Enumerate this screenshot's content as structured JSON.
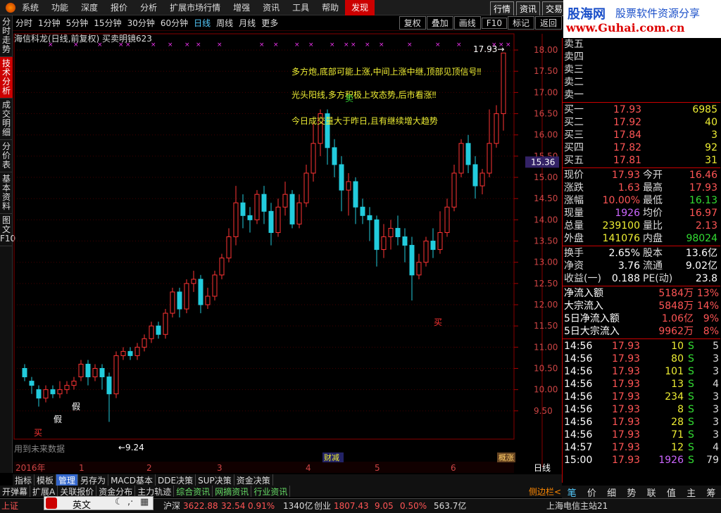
{
  "menu": [
    "系统",
    "功能",
    "深度",
    "报价",
    "分析",
    "扩展市场行情",
    "增强",
    "资讯",
    "工具",
    "帮助",
    "发现"
  ],
  "topright_btns": [
    "行情",
    "资讯",
    "交易"
  ],
  "brand": {
    "line1": "股海网",
    "line2": "股票软件资源分享",
    "line3": "www.Guhai.com.cn"
  },
  "left_tabs": [
    "分时走势",
    "技术分析",
    "成交明细",
    "分价表",
    "基本资料",
    "图文F10"
  ],
  "periods": [
    "分时",
    "1分钟",
    "5分钟",
    "15分钟",
    "30分钟",
    "60分钟",
    "日线",
    "周线",
    "月线",
    "更多"
  ],
  "active_period": "日线",
  "tool_btns": [
    "复权",
    "叠加",
    "画线",
    "F10",
    "标记",
    "返回"
  ],
  "chart_title": "海信科龙(日线,前复权) 买卖明镜623",
  "annotations": {
    "t1": "多方炮,底部可能上涨,中间上涨中继,顶部见顶信号‼",
    "t2": "光头阳线,多方积极上攻态势,后市看涨‼",
    "t3": "今日成交量大于昨日,且有继续增大趋势",
    "buy": "买",
    "fake": "假",
    "low": "9.24",
    "high": "17.93",
    "future": "用到未来数据",
    "finance": "财减",
    "caption": "概涨",
    "cur_price": "15.36"
  },
  "chart_data": {
    "type": "candlestick",
    "ylim": [
      9.0,
      18.2
    ],
    "yticks": [
      "18.00",
      "17.50",
      "17.00",
      "16.50",
      "16.00",
      "15.50",
      "15.00",
      "14.50",
      "14.00",
      "13.50",
      "13.00",
      "12.50",
      "12.00",
      "11.50",
      "11.00",
      "10.50",
      "10.00",
      "9.50"
    ],
    "xlabels": [
      "2016年",
      "1",
      "2",
      "3",
      "4",
      "5",
      "6"
    ],
    "candles": [
      [
        10.5,
        10.3,
        10.6,
        10.2
      ],
      [
        10.2,
        10.1,
        10.3,
        9.9
      ],
      [
        10.0,
        9.8,
        10.1,
        9.6
      ],
      [
        9.8,
        10.0,
        10.1,
        9.7
      ],
      [
        10.0,
        9.9,
        10.1,
        9.8
      ],
      [
        9.9,
        10.0,
        10.2,
        9.8
      ],
      [
        10.0,
        10.1,
        10.2,
        9.9
      ],
      [
        10.1,
        10.2,
        10.3,
        10.0
      ],
      [
        10.3,
        10.6,
        10.7,
        10.2
      ],
      [
        10.6,
        10.3,
        10.7,
        10.1
      ],
      [
        10.3,
        10.5,
        10.6,
        10.2
      ],
      [
        10.5,
        10.3,
        10.6,
        10.0
      ],
      [
        10.3,
        9.9,
        10.4,
        9.24
      ],
      [
        9.9,
        10.8,
        10.9,
        9.8
      ],
      [
        10.8,
        10.9,
        11.0,
        10.7
      ],
      [
        10.9,
        10.8,
        11.0,
        10.7
      ],
      [
        10.8,
        11.0,
        11.1,
        10.7
      ],
      [
        11.0,
        11.2,
        11.3,
        10.9
      ],
      [
        11.2,
        11.5,
        11.6,
        11.1
      ],
      [
        11.5,
        11.3,
        11.6,
        11.2
      ],
      [
        11.3,
        11.8,
        11.9,
        11.2
      ],
      [
        11.8,
        12.3,
        12.4,
        11.7
      ],
      [
        12.3,
        11.9,
        12.4,
        11.7
      ],
      [
        11.9,
        12.5,
        12.6,
        11.8
      ],
      [
        12.5,
        12.6,
        12.8,
        12.3
      ],
      [
        12.6,
        12.0,
        12.7,
        11.8
      ],
      [
        12.0,
        12.2,
        12.4,
        11.9
      ],
      [
        12.2,
        12.7,
        12.8,
        12.1
      ],
      [
        12.7,
        13.1,
        13.2,
        12.6
      ],
      [
        13.1,
        13.6,
        13.8,
        13.0
      ],
      [
        13.6,
        14.4,
        14.8,
        13.4
      ],
      [
        14.4,
        14.1,
        14.6,
        13.8
      ],
      [
        14.1,
        14.0,
        14.3,
        13.7
      ],
      [
        14.0,
        14.6,
        14.7,
        13.9
      ],
      [
        14.6,
        14.2,
        14.8,
        13.9
      ],
      [
        14.2,
        13.7,
        14.4,
        13.4
      ],
      [
        13.7,
        14.3,
        14.5,
        13.6
      ],
      [
        14.3,
        14.6,
        14.9,
        14.1
      ],
      [
        14.6,
        13.9,
        14.7,
        13.8
      ],
      [
        13.9,
        14.4,
        14.6,
        13.8
      ],
      [
        14.4,
        15.1,
        15.3,
        14.3
      ],
      [
        15.1,
        15.8,
        16.3,
        14.9
      ],
      [
        15.8,
        16.5,
        16.6,
        15.5
      ],
      [
        16.5,
        15.7,
        16.6,
        15.3
      ],
      [
        15.7,
        15.3,
        15.9,
        15.0
      ],
      [
        15.3,
        14.7,
        15.5,
        14.2
      ],
      [
        14.7,
        14.9,
        15.1,
        14.1
      ],
      [
        14.9,
        14.3,
        15.0,
        13.9
      ],
      [
        14.3,
        14.1,
        14.5,
        13.9
      ],
      [
        14.1,
        14.0,
        14.3,
        13.5
      ],
      [
        14.0,
        13.3,
        14.1,
        12.9
      ],
      [
        13.3,
        13.6,
        13.9,
        13.1
      ],
      [
        13.6,
        13.8,
        14.0,
        13.3
      ],
      [
        13.8,
        13.6,
        14.1,
        13.4
      ],
      [
        13.6,
        13.4,
        13.8,
        13.0
      ],
      [
        13.4,
        12.7,
        13.6,
        12.1
      ],
      [
        12.7,
        13.0,
        13.2,
        12.6
      ],
      [
        13.0,
        13.5,
        13.6,
        12.9
      ],
      [
        13.5,
        13.3,
        13.8,
        13.1
      ],
      [
        13.3,
        13.7,
        14.2,
        13.2
      ],
      [
        13.7,
        14.3,
        14.5,
        13.6
      ],
      [
        14.3,
        15.1,
        15.3,
        14.2
      ],
      [
        15.1,
        15.8,
        15.9,
        15.0
      ],
      [
        15.8,
        15.3,
        16.0,
        15.1
      ],
      [
        15.3,
        14.8,
        15.5,
        14.5
      ],
      [
        14.8,
        15.1,
        15.2,
        14.6
      ],
      [
        15.1,
        15.8,
        16.6,
        15.0
      ],
      [
        15.8,
        16.5,
        16.7,
        15.7
      ],
      [
        16.5,
        17.93,
        17.93,
        16.1
      ]
    ]
  },
  "quote": {
    "sell": [
      "卖五",
      "卖四",
      "卖三",
      "卖二",
      "卖一"
    ],
    "buy": [
      [
        "买一",
        "17.93",
        "6985"
      ],
      [
        "买二",
        "17.92",
        "40"
      ],
      [
        "买三",
        "17.84",
        "3"
      ],
      [
        "买四",
        "17.82",
        "92"
      ],
      [
        "买五",
        "17.81",
        "31"
      ]
    ],
    "stats": [
      [
        "现价",
        "17.93",
        "今开",
        "16.46"
      ],
      [
        "涨跌",
        "1.63",
        "最高",
        "17.93"
      ],
      [
        "涨幅",
        "10.00%",
        "最低",
        "16.13"
      ],
      [
        "现量",
        "1926",
        "均价",
        "16.97"
      ],
      [
        "总量",
        "239100",
        "量比",
        "2.13"
      ],
      [
        "外盘",
        "141076",
        "内盘",
        "98024"
      ]
    ],
    "stats2": [
      [
        "换手",
        "2.65%",
        "股本",
        "13.6亿"
      ],
      [
        "净资",
        "3.76",
        "流通",
        "9.02亿"
      ],
      [
        "收益(一)",
        "0.188",
        "PE(动)",
        "23.8"
      ]
    ],
    "flow": [
      [
        "净流入额",
        "5184万",
        "13%"
      ],
      [
        "大宗流入",
        "5848万",
        "14%"
      ],
      [
        "5日净流入额",
        "1.06亿",
        "9%"
      ],
      [
        "5日大宗流入",
        "9962万",
        "8%"
      ]
    ],
    "ticks": [
      [
        "14:56",
        "17.93",
        "10",
        "S",
        "5"
      ],
      [
        "14:56",
        "17.93",
        "80",
        "S",
        "3"
      ],
      [
        "14:56",
        "17.93",
        "101",
        "S",
        "3"
      ],
      [
        "14:56",
        "17.93",
        "13",
        "S",
        "4"
      ],
      [
        "14:56",
        "17.93",
        "234",
        "S",
        "3"
      ],
      [
        "14:56",
        "17.93",
        "8",
        "S",
        "3"
      ],
      [
        "14:56",
        "17.93",
        "28",
        "S",
        "3"
      ],
      [
        "14:56",
        "17.93",
        "71",
        "S",
        "3"
      ],
      [
        "14:57",
        "17.93",
        "12",
        "S",
        "4"
      ],
      [
        "15:00",
        "17.93",
        "1926",
        "S",
        "79"
      ]
    ]
  },
  "bottom_tabs": [
    "指标",
    "模板",
    "管理",
    "另存为",
    "MACD基本",
    "DDE决策",
    "SUP决策",
    "资金决策"
  ],
  "bottom_tabs2": [
    "开弹幕",
    "扩展A",
    "关联报价",
    "资金分布",
    "主力轨迹",
    "综合资讯",
    "网摘资讯",
    "行业资讯"
  ],
  "side_label": "侧边栏<",
  "day_line": "日线",
  "right_tabs": [
    "笔",
    "价",
    "细",
    "势",
    "联",
    "值",
    "主",
    "筹"
  ],
  "status": {
    "sh_label": "上证",
    "hs_label": "沪深",
    "hs_val": "3622.88",
    "hs_chg": "32.54",
    "hs_pct": "0.91%",
    "hs_amt": "1340亿",
    "cy_label": "创业",
    "cy_val": "1807.43",
    "cy_chg": "9.05",
    "cy_pct": "0.50%",
    "cy_amt": "563.7亿",
    "server": "上海电信主站21"
  },
  "ime": {
    "lang": "英文"
  }
}
